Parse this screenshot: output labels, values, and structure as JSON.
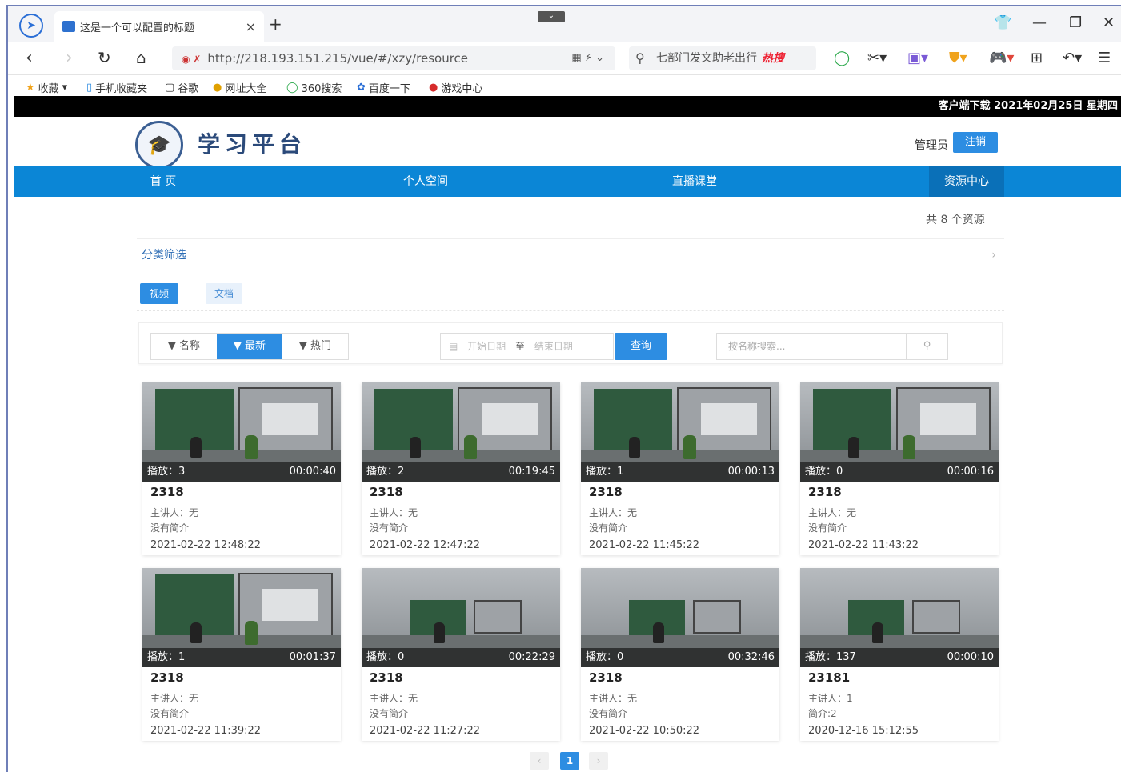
{
  "browser": {
    "tab_title": "这是一个可以配置的标题",
    "url": "http://218.193.151.215/vue/#/xzy/resource",
    "search_text": "七部门发文助老出行",
    "search_hot": "热搜",
    "bookmarks": [
      "收藏",
      "手机收藏夹",
      "谷歌",
      "网址大全",
      "360搜索",
      "百度一下",
      "游戏中心"
    ]
  },
  "site": {
    "topstrip": "客户端下载  2021年02月25日 星期四",
    "logo_text": "学习平台",
    "admin_label": "管理员",
    "logout_label": "注销",
    "menu": [
      "首 页",
      "个人空间",
      "直播课堂",
      "资源中心"
    ],
    "active_menu": "资源中心"
  },
  "resources": {
    "count_text": "共 8 个资源",
    "filter_label": "分类筛选",
    "types": [
      "视频",
      "文档"
    ],
    "sort_buttons": [
      "▼ 名称",
      "▼ 最新",
      "▼ 热门"
    ],
    "date_start_placeholder": "开始日期",
    "date_sep": "至",
    "date_end_placeholder": "结束日期",
    "query_label": "查询",
    "search_placeholder": "按名称搜索...",
    "cards": [
      {
        "plays": "播放：3",
        "duration": "00:00:40",
        "title": "2318",
        "speaker": "主讲人：无",
        "intro": "没有简介",
        "date": "2021-02-22 12:48:22"
      },
      {
        "plays": "播放：2",
        "duration": "00:19:45",
        "title": "2318",
        "speaker": "主讲人：无",
        "intro": "没有简介",
        "date": "2021-02-22 12:47:22"
      },
      {
        "plays": "播放：1",
        "duration": "00:00:13",
        "title": "2318",
        "speaker": "主讲人：无",
        "intro": "没有简介",
        "date": "2021-02-22 11:45:22"
      },
      {
        "plays": "播放：0",
        "duration": "00:00:16",
        "title": "2318",
        "speaker": "主讲人：无",
        "intro": "没有简介",
        "date": "2021-02-22 11:43:22"
      },
      {
        "plays": "播放：1",
        "duration": "00:01:37",
        "title": "2318",
        "speaker": "主讲人：无",
        "intro": "没有简介",
        "date": "2021-02-22 11:39:22"
      },
      {
        "plays": "播放：0",
        "duration": "00:22:29",
        "title": "2318",
        "speaker": "主讲人：无",
        "intro": "没有简介",
        "date": "2021-02-22 11:27:22"
      },
      {
        "plays": "播放：0",
        "duration": "00:32:46",
        "title": "2318",
        "speaker": "主讲人：无",
        "intro": "没有简介",
        "date": "2021-02-22 10:50:22"
      },
      {
        "plays": "播放：137",
        "duration": "00:00:10",
        "title": "23181",
        "speaker": "主讲人：1",
        "intro": "简介:2",
        "date": "2020-12-16 15:12:55"
      }
    ],
    "pager": {
      "prev": "‹",
      "current": "1",
      "next": "›"
    }
  },
  "colors": {
    "accent": "#2d8de2",
    "menu_bg": "#0b86d6"
  }
}
